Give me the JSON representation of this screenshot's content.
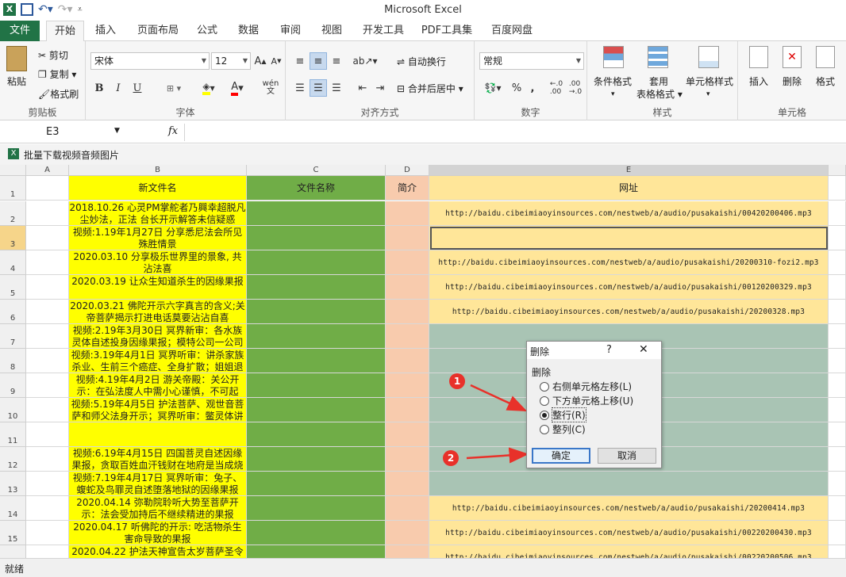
{
  "app": {
    "title": "Microsoft Excel"
  },
  "ribbon_tabs": [
    "文件",
    "开始",
    "插入",
    "页面布局",
    "公式",
    "数据",
    "审阅",
    "视图",
    "开发工具",
    "PDF工具集",
    "百度网盘"
  ],
  "clipboard": {
    "paste": "粘贴",
    "cut": "剪切",
    "copy": "复制",
    "format_painter": "格式刷",
    "group": "剪贴板"
  },
  "font": {
    "name": "宋体",
    "size": "12",
    "bold": "B",
    "italic": "I",
    "underline": "U",
    "group": "字体",
    "wen": "wén"
  },
  "align": {
    "wrap": "自动换行",
    "merge": "合并后居中",
    "group": "对齐方式"
  },
  "number": {
    "format": "常规",
    "percent": "%",
    "comma": ",",
    "group": "数字"
  },
  "styles": {
    "cond": "条件格式",
    "table1": "套用",
    "table2": "表格格式",
    "cell": "单元格样式",
    "group": "样式"
  },
  "cells": {
    "insert": "插入",
    "delete": "删除",
    "format": "格式",
    "group": "单元格"
  },
  "formula_bar": {
    "name_box": "E3",
    "fx": "fx",
    "value": ""
  },
  "sheet_title": "批量下载视频音频图片",
  "columns": [
    "A",
    "B",
    "C",
    "D",
    "E"
  ],
  "header_row": {
    "b": "新文件名",
    "c": "文件名称",
    "d": "简介",
    "e": "网址"
  },
  "rows": [
    {
      "n": "1"
    },
    {
      "n": "2",
      "b": "2018.10.26 心灵PM掌舵者乃興幸超脱凡尘妙法，正法 台长开示解答未信疑惑",
      "e": "http://baidu.cibeimiaoyinsources.com/nestweb/a/audio/pusakaishi/00420200406.mp3"
    },
    {
      "n": "3",
      "b": "视频:1.19年1月27日 分享悉尼法会所见殊胜情景",
      "e": ""
    },
    {
      "n": "4",
      "b": "2020.03.10 分享极乐世界里的景象, 共沾法喜",
      "e": "http://baidu.cibeimiaoyinsources.com/nestweb/a/audio/pusakaishi/20200310-fozi2.mp3"
    },
    {
      "n": "5",
      "b": "2020.03.19 让众生知道杀生的因缘果报",
      "e": "http://baidu.cibeimiaoyinsources.com/nestweb/a/audio/pusakaishi/00120200329.mp3"
    },
    {
      "n": "6",
      "b": "2020.03.21 佛陀开示六字真言的含义;关帝菩萨揭示打进电话莫要沾沾自喜",
      "e": "http://baidu.cibeimiaoyinsources.com/nestweb/a/audio/pusakaishi/20200328.mp3"
    },
    {
      "n": "7",
      "b": "视频:2.19年3月30日 冥界新审：各水族灵体自述投身因缘果报；模特公司一公司",
      "e": ""
    },
    {
      "n": "8",
      "b": "视频:3.19年4月1日 冥界听审：讲杀家族杀业、生前三个癌症、全身扩散；姐姐退",
      "e": ""
    },
    {
      "n": "9",
      "b": "视频:4.19年4月2日 游关帝殿：关公开示：在弘法度人中需小心谨慎，不可起",
      "e": ""
    },
    {
      "n": "10",
      "b": "视频:5.19年4月5日 护法菩萨、观世音菩萨和师父法身开示；冥界听审：鳖灵体讲",
      "e": ""
    },
    {
      "n": "11",
      "b": "",
      "e": ""
    },
    {
      "n": "12",
      "b": "视频:6.19年4月15日 四国菩灵自述因缘果报，贪取百姓血汗钱财在地府是当成烧",
      "e": ""
    },
    {
      "n": "13",
      "b": "视频:7.19年4月17日 冥界听审：兔子、蝮蛇及鸟罪灵自述堕落地狱的因缘果报",
      "e": ""
    },
    {
      "n": "14",
      "b": "2020.04.14 弥勒院聆听大势至菩萨开示：法会受加持后不继续精进的果报",
      "e": "http://baidu.cibeimiaoyinsources.com/nestweb/a/audio/pusakaishi/20200414.mp3"
    },
    {
      "n": "15",
      "b": "2020.04.17 听佛陀的开示: 吃活物杀生害命导致的果报",
      "e": "http://baidu.cibeimiaoyinsources.com/nestweb/a/audio/pusakaishi/00220200430.mp3"
    },
    {
      "n": "",
      "b": "2020.04.22 护法天神宣告太岁菩萨圣令",
      "e": "http://baidu.cibeimiaoyinsources.com/nestweb/a/audio/pusakaishi/00220200506.mp3"
    }
  ],
  "dialog": {
    "title": "删除",
    "help": "?",
    "close": "✕",
    "group": "删除",
    "options": [
      "右侧单元格左移(L)",
      "下方单元格上移(U)",
      "整行(R)",
      "整列(C)"
    ],
    "selected_index": 2,
    "ok": "确定",
    "cancel": "取消"
  },
  "annotations": [
    "1",
    "2"
  ],
  "status": {
    "ready": "就绪"
  },
  "colors": {
    "green": "#70ad47",
    "yellow": "#ffff00",
    "peach": "#f8cbad",
    "url_bg": "#ffe699",
    "selected_rows": "#a9c4b4",
    "excel_green": "#217346",
    "arrow": "#e8312a"
  }
}
